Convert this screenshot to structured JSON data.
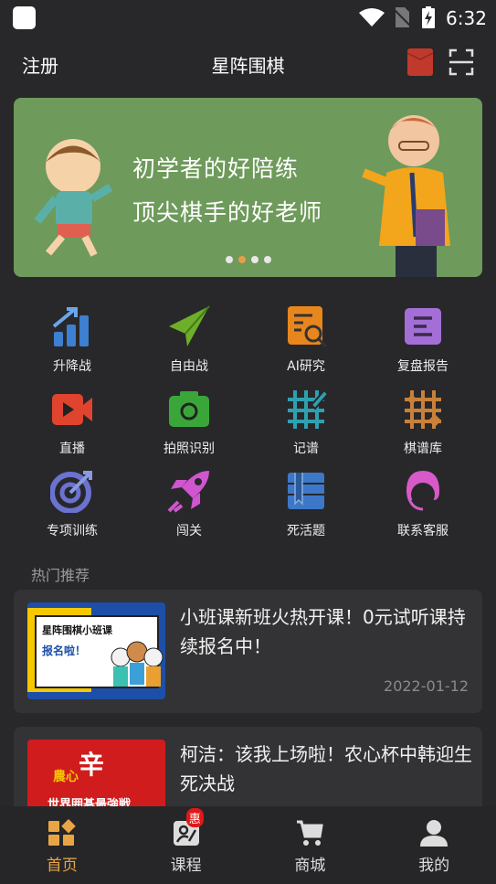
{
  "status": {
    "time": "6:32"
  },
  "header": {
    "left": "注册",
    "title": "星阵围棋",
    "icons": [
      "red-envelope-icon",
      "scan-icon"
    ]
  },
  "banner": {
    "line1": "初学者的好陪练",
    "line2": "顶尖棋手的好老师",
    "page_count": 4,
    "active_page": 2
  },
  "grid": [
    {
      "label": "升降战",
      "icon": "rank-chart-icon",
      "color": "#3d7fd0"
    },
    {
      "label": "自由战",
      "icon": "paper-plane-icon",
      "color": "#6fae2a"
    },
    {
      "label": "AI研究",
      "icon": "document-search-icon",
      "color": "#e8861e"
    },
    {
      "label": "复盘报告",
      "icon": "report-icon",
      "color": "#a36fd6"
    },
    {
      "label": "直播",
      "icon": "video-camera-icon",
      "color": "#e0442f"
    },
    {
      "label": "拍照识别",
      "icon": "camera-icon",
      "color": "#3aa63a"
    },
    {
      "label": "记谱",
      "icon": "board-pencil-icon",
      "color": "#2fa0b0"
    },
    {
      "label": "棋谱库",
      "icon": "board-grid-icon",
      "color": "#c9813a"
    },
    {
      "label": "专项训练",
      "icon": "target-icon",
      "color": "#6b72d0"
    },
    {
      "label": "闯关",
      "icon": "rocket-icon",
      "color": "#d055cf"
    },
    {
      "label": "死活题",
      "icon": "book-icon",
      "color": "#3d78c8"
    },
    {
      "label": "联系客服",
      "icon": "customer-service-icon",
      "color": "#d85ac8"
    }
  ],
  "section": {
    "title": "热门推荐"
  },
  "articles": [
    {
      "title": "小班课新班火热开课！0元试听课持续报名中！",
      "date": "2022-01-12",
      "thumb_text": [
        "星阵围棋小班课",
        "报名啦！"
      ]
    },
    {
      "title": "柯洁：该我上场啦！农心杯中韩迎生死决战",
      "thumb_text": [
        "農心",
        "辛",
        "世界囲碁最強戦"
      ]
    }
  ],
  "nav": [
    {
      "label": "首页",
      "icon": "home-grid-icon",
      "active": true
    },
    {
      "label": "课程",
      "icon": "course-icon",
      "badge": "惠"
    },
    {
      "label": "商城",
      "icon": "cart-icon"
    },
    {
      "label": "我的",
      "icon": "user-icon"
    }
  ],
  "colors": {
    "accent": "#e9a545",
    "banner": "#6e9a5b",
    "background": "#28282a"
  }
}
